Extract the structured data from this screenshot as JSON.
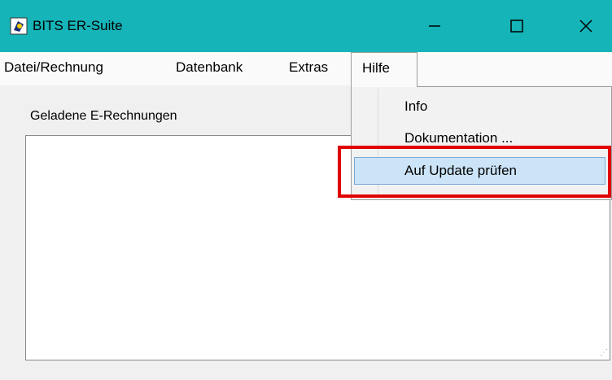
{
  "window": {
    "title": "BITS ER-Suite",
    "title_bar_color": "#15b4b8"
  },
  "menubar": {
    "items": [
      {
        "label": "Datei/Rechnung"
      },
      {
        "label": "Datenbank"
      },
      {
        "label": "Extras"
      },
      {
        "label": "Hilfe",
        "state": "open"
      }
    ]
  },
  "dropdown": {
    "items": [
      {
        "label": "Info"
      },
      {
        "label": "Dokumentation ..."
      },
      {
        "label": "Auf Update prüfen",
        "highlighted": true
      }
    ]
  },
  "main": {
    "loaded_label": "Geladene E-Rechnungen"
  },
  "annotation": {
    "color": "#e00000",
    "target": "Auf Update prüfen"
  }
}
